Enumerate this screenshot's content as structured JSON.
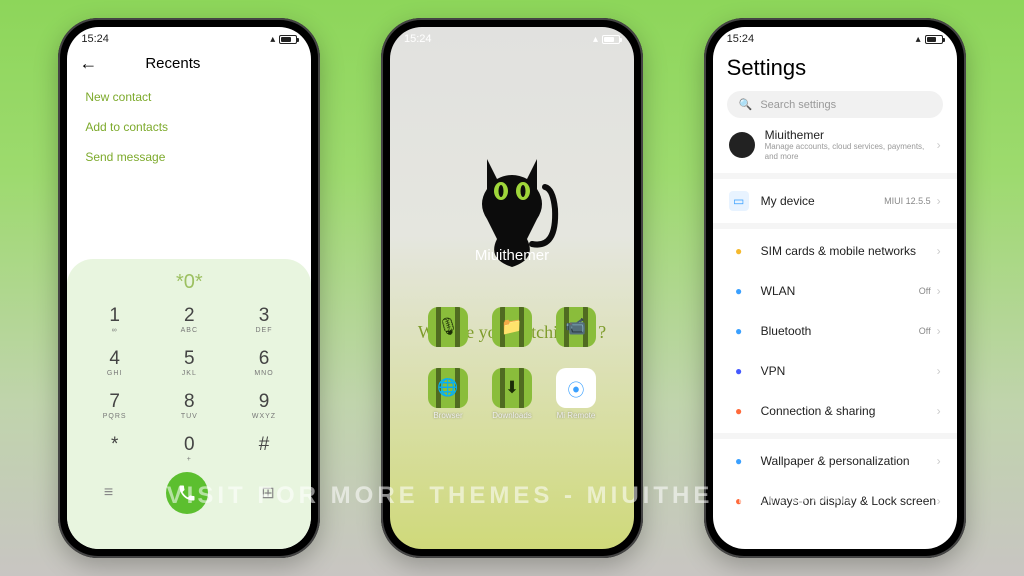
{
  "status": {
    "time": "15:24"
  },
  "watermark": "VISIT FOR MORE THEMES - MIUITHEMER.COM",
  "dialer": {
    "title": "Recents",
    "menu": [
      "New contact",
      "Add to contacts",
      "Send message"
    ],
    "typed": "*0*",
    "keys": [
      {
        "n": "1",
        "l": "∞"
      },
      {
        "n": "2",
        "l": "ABC"
      },
      {
        "n": "3",
        "l": "DEF"
      },
      {
        "n": "4",
        "l": "GHI"
      },
      {
        "n": "5",
        "l": "JKL"
      },
      {
        "n": "6",
        "l": "MNO"
      },
      {
        "n": "7",
        "l": "PQRS"
      },
      {
        "n": "8",
        "l": "TUV"
      },
      {
        "n": "9",
        "l": "WXYZ"
      },
      {
        "n": "*",
        "l": ""
      },
      {
        "n": "0",
        "l": "+"
      },
      {
        "n": "#",
        "l": ""
      }
    ]
  },
  "home": {
    "brand": "Miuithemer",
    "tagline": "What're you watching at ?",
    "apps": [
      {
        "label": "",
        "glyph": "🎙"
      },
      {
        "label": "",
        "glyph": "📁"
      },
      {
        "label": "",
        "glyph": "📹"
      },
      {
        "label": "Browser",
        "glyph": "🌐"
      },
      {
        "label": "Downloads",
        "glyph": "⬇"
      },
      {
        "label": "Mi Remote",
        "glyph": "⦿",
        "white": true
      }
    ]
  },
  "settings": {
    "title": "Settings",
    "search_placeholder": "Search settings",
    "account": {
      "name": "Miuithemer",
      "sub": "Manage accounts, cloud services, payments, and more"
    },
    "myDevice": {
      "label": "My device",
      "value": "MIUI 12.5.5"
    },
    "rows": [
      {
        "icon": "sim",
        "color": "#f5b92e",
        "label": "SIM cards & mobile networks",
        "value": ""
      },
      {
        "icon": "wifi",
        "color": "#3aa0ff",
        "label": "WLAN",
        "value": "Off"
      },
      {
        "icon": "bt",
        "color": "#3aa0ff",
        "label": "Bluetooth",
        "value": "Off"
      },
      {
        "icon": "vpn",
        "color": "#4459ff",
        "label": "VPN",
        "value": ""
      },
      {
        "icon": "share",
        "color": "#ff6a3a",
        "label": "Connection & sharing",
        "value": ""
      }
    ],
    "rows2": [
      {
        "icon": "wall",
        "color": "#3aa0ff",
        "label": "Wallpaper & personalization"
      },
      {
        "icon": "lock",
        "color": "#ff6a3a",
        "label": "Always-on display & Lock screen"
      }
    ]
  }
}
